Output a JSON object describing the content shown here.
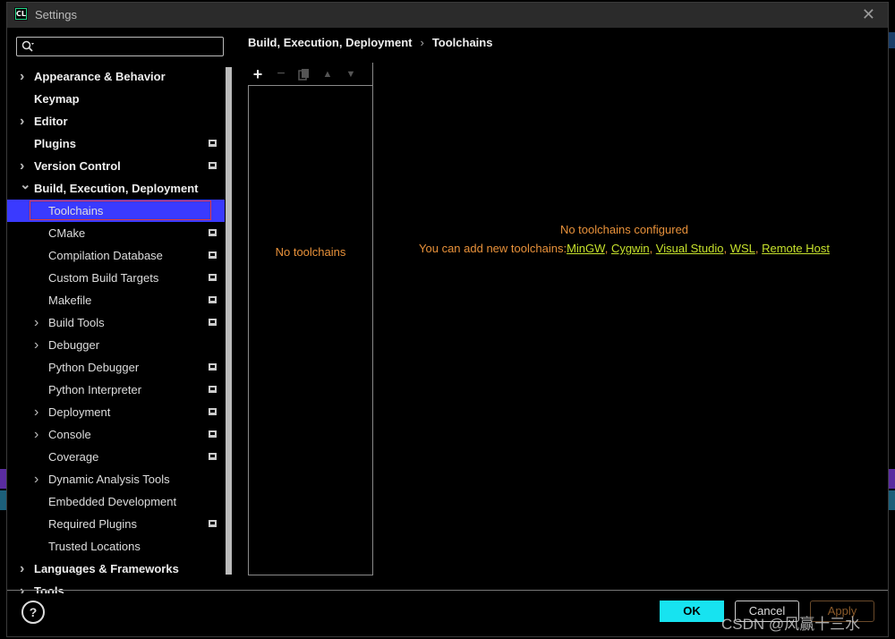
{
  "window": {
    "title": "Settings",
    "app_icon_text": "CL"
  },
  "search": {
    "placeholder": ""
  },
  "tree": [
    {
      "label": "Appearance & Behavior",
      "level": 0,
      "expandable": true,
      "expanded": false,
      "project": false
    },
    {
      "label": "Keymap",
      "level": 0,
      "expandable": false,
      "expanded": false,
      "project": false
    },
    {
      "label": "Editor",
      "level": 0,
      "expandable": true,
      "expanded": false,
      "project": false
    },
    {
      "label": "Plugins",
      "level": 0,
      "expandable": false,
      "expanded": false,
      "project": true
    },
    {
      "label": "Version Control",
      "level": 0,
      "expandable": true,
      "expanded": false,
      "project": true
    },
    {
      "label": "Build, Execution, Deployment",
      "level": 0,
      "expandable": true,
      "expanded": true,
      "project": false
    },
    {
      "label": "Toolchains",
      "level": 1,
      "expandable": false,
      "expanded": false,
      "project": false,
      "selected": true
    },
    {
      "label": "CMake",
      "level": 1,
      "expandable": false,
      "expanded": false,
      "project": true
    },
    {
      "label": "Compilation Database",
      "level": 1,
      "expandable": false,
      "expanded": false,
      "project": true
    },
    {
      "label": "Custom Build Targets",
      "level": 1,
      "expandable": false,
      "expanded": false,
      "project": true
    },
    {
      "label": "Makefile",
      "level": 1,
      "expandable": false,
      "expanded": false,
      "project": true
    },
    {
      "label": "Build Tools",
      "level": 1,
      "expandable": true,
      "expanded": false,
      "project": true
    },
    {
      "label": "Debugger",
      "level": 1,
      "expandable": true,
      "expanded": false,
      "project": false
    },
    {
      "label": "Python Debugger",
      "level": 1,
      "expandable": false,
      "expanded": false,
      "project": true
    },
    {
      "label": "Python Interpreter",
      "level": 1,
      "expandable": false,
      "expanded": false,
      "project": true
    },
    {
      "label": "Deployment",
      "level": 1,
      "expandable": true,
      "expanded": false,
      "project": true
    },
    {
      "label": "Console",
      "level": 1,
      "expandable": true,
      "expanded": false,
      "project": true
    },
    {
      "label": "Coverage",
      "level": 1,
      "expandable": false,
      "expanded": false,
      "project": true
    },
    {
      "label": "Dynamic Analysis Tools",
      "level": 1,
      "expandable": true,
      "expanded": false,
      "project": false
    },
    {
      "label": "Embedded Development",
      "level": 1,
      "expandable": false,
      "expanded": false,
      "project": false
    },
    {
      "label": "Required Plugins",
      "level": 1,
      "expandable": false,
      "expanded": false,
      "project": true
    },
    {
      "label": "Trusted Locations",
      "level": 1,
      "expandable": false,
      "expanded": false,
      "project": false
    },
    {
      "label": "Languages & Frameworks",
      "level": 0,
      "expandable": true,
      "expanded": false,
      "project": false
    },
    {
      "label": "Tools",
      "level": 0,
      "expandable": true,
      "expanded": false,
      "project": false
    }
  ],
  "breadcrumb": {
    "parent": "Build, Execution, Deployment",
    "separator": "›",
    "current": "Toolchains"
  },
  "toolbar": {
    "add": "+",
    "remove": "−",
    "copy": "copy",
    "up": "▲",
    "down": "▼"
  },
  "list": {
    "empty_text": "No toolchains"
  },
  "message": {
    "line1": "No toolchains configured",
    "line2_prefix": "You can add new toolchains:",
    "links": [
      "MinGW",
      "Cygwin",
      "Visual Studio",
      "WSL",
      "Remote Host"
    ]
  },
  "buttons": {
    "ok": "OK",
    "cancel": "Cancel",
    "apply": "Apply",
    "help": "?"
  },
  "watermark": "CSDN @风赢十三水",
  "colors": {
    "accent_selection": "#3a3aff",
    "warning_text": "#e8913a",
    "link": "#c6e12c",
    "ok_button": "#17e3f0",
    "highlight_border": "#e53935"
  }
}
